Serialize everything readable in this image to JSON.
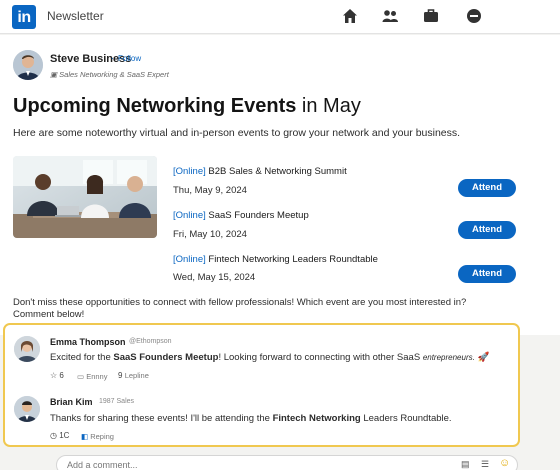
{
  "app": {
    "logo_text": "in",
    "title": "Newsletter"
  },
  "nav": {
    "icons": [
      "home-icon",
      "network-icon",
      "jobs-icon",
      "notifications-icon"
    ]
  },
  "colors": {
    "brand": "#0a66c2",
    "highlight_border": "#f0c850"
  },
  "author": {
    "name": "Steve Business",
    "follow": "Follow",
    "subtitle": "Sales Networking & SaaS Expert"
  },
  "article": {
    "title_bold": "Upcoming Networking Events",
    "title_rest": " in May",
    "intro": "Here are some noteworthy virtual and in-person events to grow your network and your business.",
    "events": [
      {
        "tag": "[Online]",
        "name": " B2B Sales & Networking Summit",
        "date": "Thu, May 9, 2024",
        "button": "Attend"
      },
      {
        "tag": "[Online]",
        "name": " SaaS Founders Meetup",
        "date": "Fri, May 10, 2024",
        "button": "Attend"
      },
      {
        "tag": "[Online]",
        "name": " Fintech Networking Leaders  Roundtable",
        "date": "Wed, May 15, 2024",
        "button": "Attend"
      }
    ],
    "closing": "Don't miss these opportunities to connect with fellow professionals! Which event are you most interested in? Comment below!"
  },
  "comments": [
    {
      "name": "Emma Thompson",
      "handle": "@Ethompson",
      "text_before": "Excited for the ",
      "text_bold": "SaaS Founders Meetup",
      "text_after": "! Looking forward to connecting with other SaaS ",
      "text_small": "entrepreneurs.",
      "likes": "6",
      "reply_label": "Ennny",
      "replies": "9",
      "reply_count_label": "Lepline"
    },
    {
      "name": "Brian Kim",
      "handle": "1987 Sales",
      "text_before": "Thanks for sharing these events! I'll be attending the ",
      "text_bold": "Fintech Networking",
      "text_after": " Leaders Roundtable.",
      "likes": "1C",
      "reply_label": "Reping"
    }
  ],
  "comment_input": {
    "placeholder": "Add a comment..."
  }
}
